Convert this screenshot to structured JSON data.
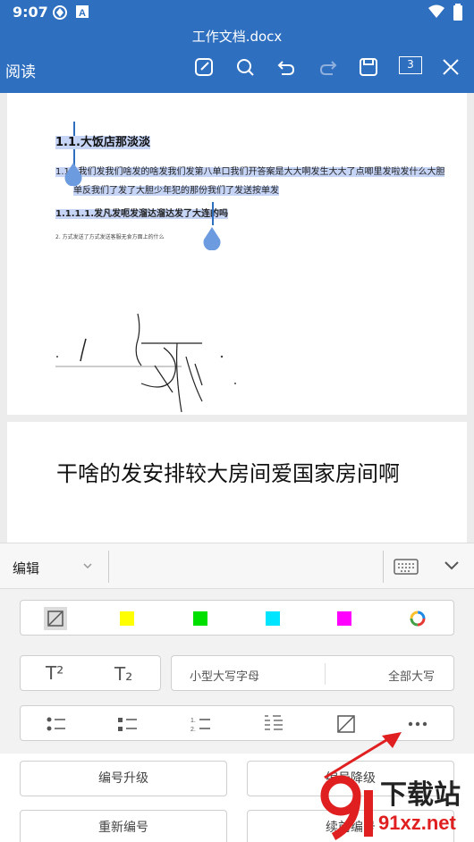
{
  "status_bar": {
    "time": "9:07"
  },
  "app_bar": {
    "title": "工作文档.docx",
    "mode": "阅读",
    "page_count": "3"
  },
  "document": {
    "heading1": "1.1.大饭店那淡淡",
    "para1_line1": "1.1.1我们发我们啥发的啥发我们发第八单口我们开答案是大大啊发生大大了点唧里发啦发什么大胆",
    "para1_line2": "单反我们了发了大胆少年犯的那份我们了发送按单发",
    "heading3": "1.1.1.1.发凡发呃发溜达溜达发了大连的吗",
    "note": "2.    方式发送了方式发送客服无食方面上的什么",
    "page2_text": "干啥的发安排较大房间爱国家房间啊"
  },
  "panel": {
    "mode_label": "编辑",
    "colors": [
      "#ffff00",
      "#00e000",
      "#00e5ff",
      "#ff00ff"
    ],
    "superscript": "T²",
    "subscript": "T₂",
    "small_caps": "小型大写字母",
    "all_caps": "全部大写",
    "promote": "编号升级",
    "demote": "编号降级",
    "renumber": "重新编号",
    "continue_number": "续前编号"
  },
  "watermark": {
    "brand": "下载站",
    "url": "91xz.net"
  }
}
